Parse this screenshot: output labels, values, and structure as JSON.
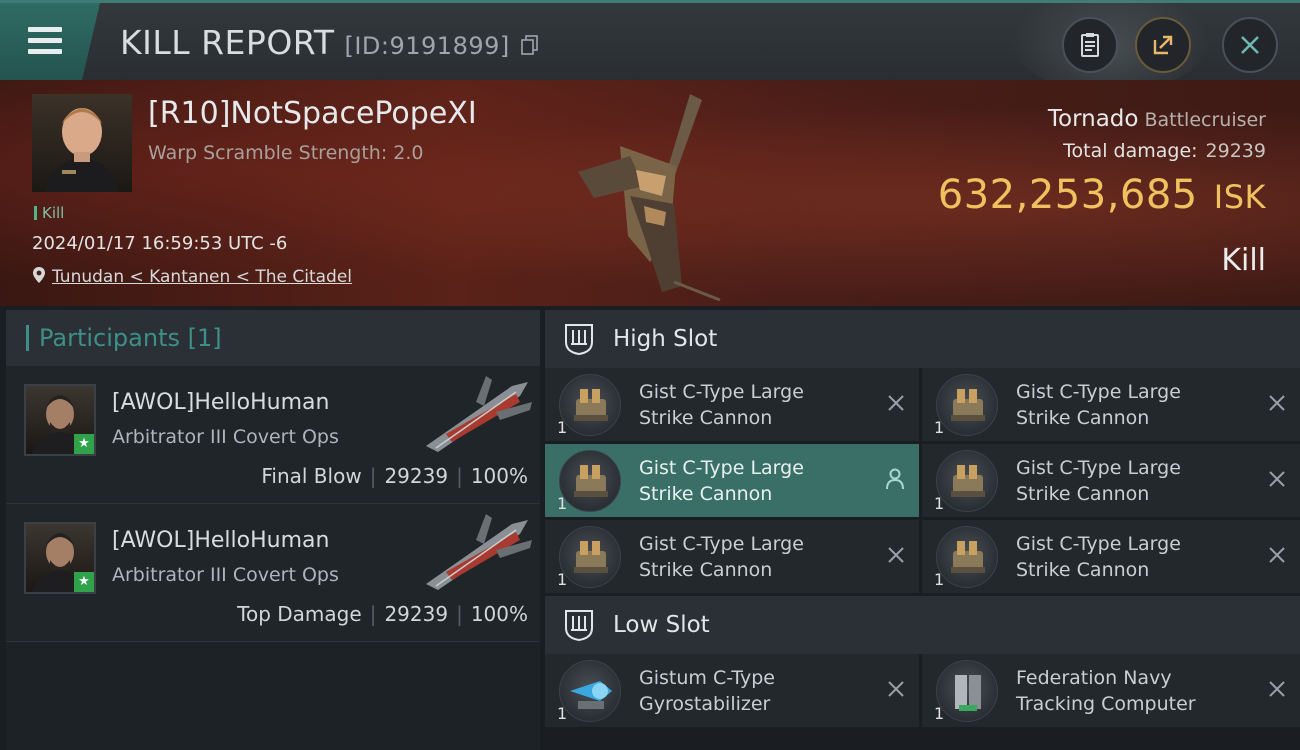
{
  "titlebar": {
    "title": "KILL REPORT",
    "report_id": "[ID:9191899]",
    "buttons": [
      "clipboard-icon",
      "share-icon",
      "close-icon"
    ]
  },
  "victim": {
    "name": "[R10]NotSpacePopeXI",
    "warp_scramble": "Warp Scramble Strength: 2.0",
    "tag": "Kill",
    "timestamp": "2024/01/17 16:59:53 UTC -6",
    "location": "Tunudan < Kantanen < The Citadel",
    "ship_name": "Tornado",
    "ship_class": "Battlecruiser",
    "damage_label": "Total damage:",
    "damage_value": "29239",
    "isk_value": "632,253,685",
    "isk_unit": "ISK",
    "result": "Kill"
  },
  "participants": {
    "header": "Participants [1]",
    "rows": [
      {
        "name": "[AWOL]HelloHuman",
        "ship": "Arbitrator III Covert Ops",
        "role": "Final Blow",
        "damage": "29239",
        "percent": "100%"
      },
      {
        "name": "[AWOL]HelloHuman",
        "ship": "Arbitrator III Covert Ops",
        "role": "Top Damage",
        "damage": "29239",
        "percent": "100%"
      }
    ]
  },
  "slots": {
    "high": {
      "label": "High Slot",
      "modules": [
        {
          "line1": "Gist C-Type Large",
          "line2": "Strike Cannon",
          "qty": "1"
        },
        {
          "line1": "Gist C-Type Large",
          "line2": "Strike Cannon",
          "qty": "1"
        },
        {
          "line1": "Gist C-Type Large",
          "line2": "Strike Cannon",
          "qty": "1"
        },
        {
          "line1": "Gist C-Type Large",
          "line2": "Strike Cannon",
          "qty": "1"
        },
        {
          "line1": "Gist C-Type Large",
          "line2": "Strike Cannon",
          "qty": "1"
        },
        {
          "line1": "Gist C-Type Large",
          "line2": "Strike Cannon",
          "qty": "1"
        }
      ]
    },
    "low": {
      "label": "Low Slot",
      "modules": [
        {
          "line1": "Gistum C-Type",
          "line2": "Gyrostabilizer",
          "qty": "1"
        },
        {
          "line1": "Federation Navy",
          "line2": "Tracking Computer",
          "qty": "1"
        }
      ]
    }
  },
  "colors": {
    "accent": "#3e8f88",
    "isk": "#f0c25f",
    "selected": "#3a6f68"
  }
}
